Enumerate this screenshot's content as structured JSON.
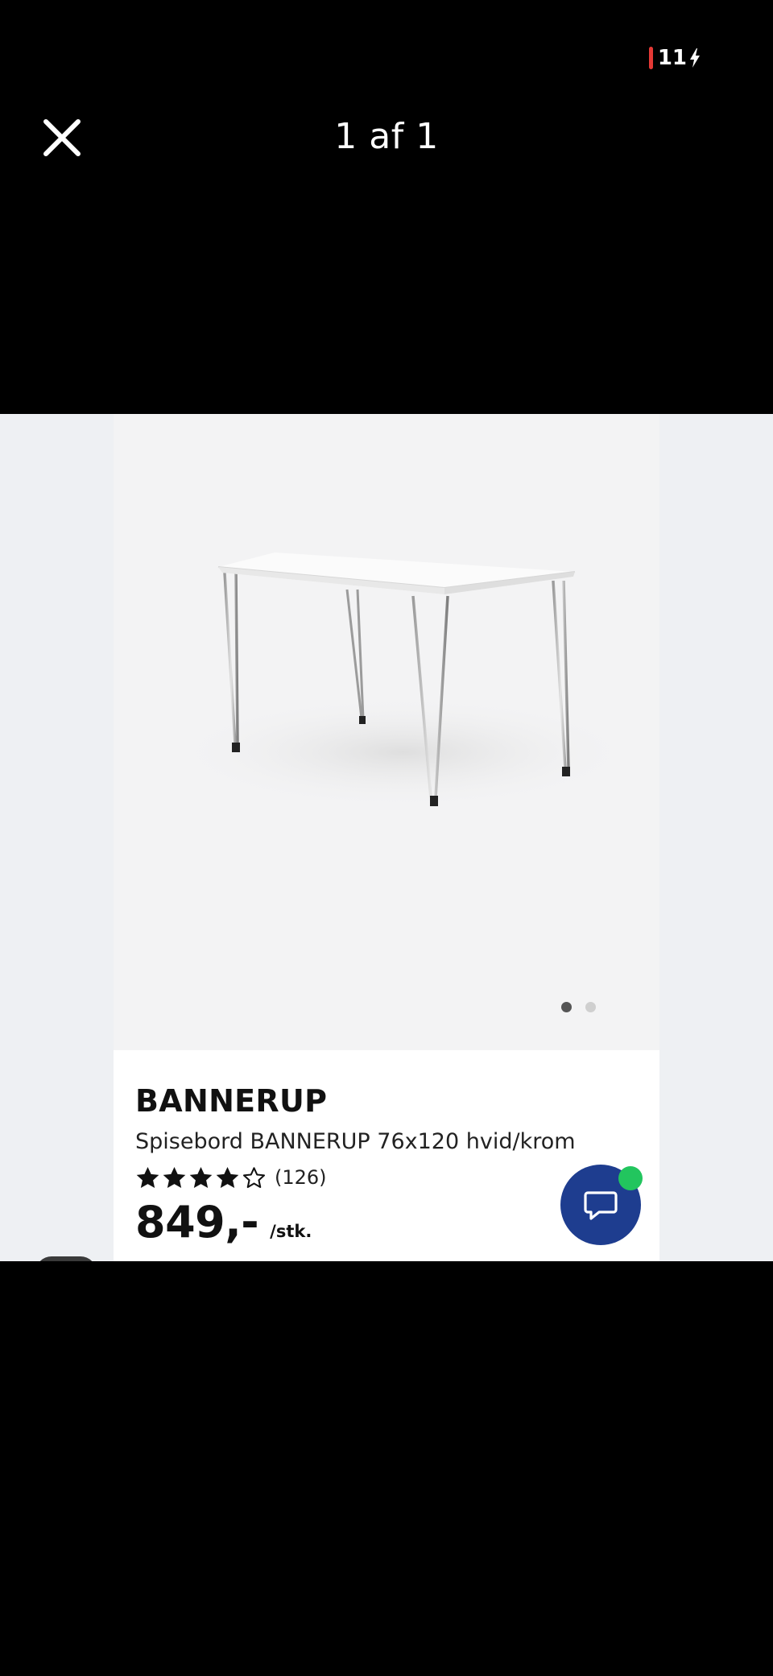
{
  "status_bar": {
    "battery_level": "11",
    "battery_color": "#e53935"
  },
  "viewer": {
    "close_icon": "close-icon",
    "counter": "1 af 1"
  },
  "product": {
    "name": "BANNERUP",
    "description": "Spisebord BANNERUP 76x120 hvid/krom",
    "rating": 4,
    "rating_max": 5,
    "review_count": "(126)",
    "price": "849,-",
    "unit": "/stk.",
    "image_count": 2,
    "active_image": 1
  },
  "chat": {
    "icon": "chat-bubble-icon",
    "button_color": "#1e3d8f",
    "online_color": "#22c55e"
  }
}
